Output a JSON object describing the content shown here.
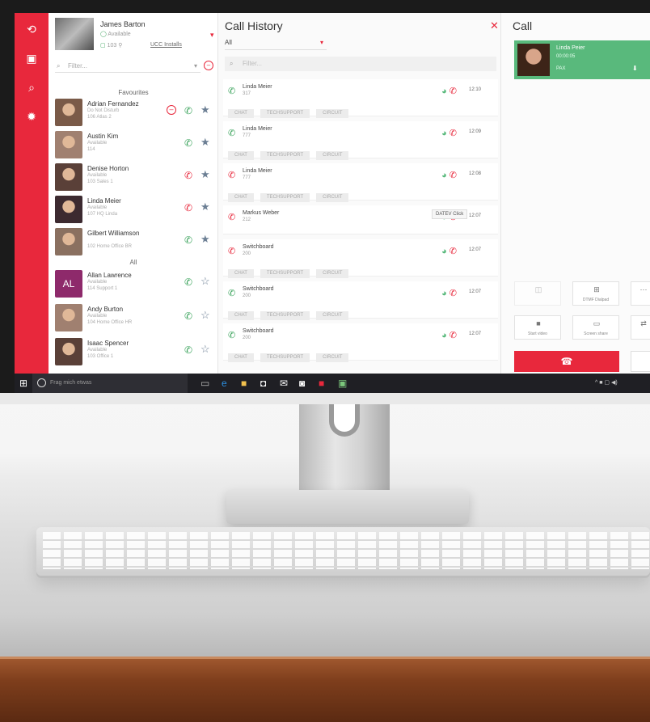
{
  "colors": {
    "accent": "#e8283c",
    "active_call": "#59b97c",
    "available": "#3aa35b"
  },
  "rail": {
    "icons": [
      "history-icon",
      "contacts-icon",
      "search-icon",
      "settings-icon"
    ]
  },
  "user": {
    "name": "James Barton",
    "status": "Available",
    "extension": "103",
    "uc_link": "UCC Installs"
  },
  "contacts": {
    "filter_placeholder": "Filter...",
    "favourites_label": "Favourites",
    "all_label": "All",
    "favourites": [
      {
        "name": "Adrian Fernandez",
        "status": "Do Not Disturb",
        "detail": "106  Atlas 2",
        "phone_color": "#3aa35b",
        "dnd": true
      },
      {
        "name": "Austin Kim",
        "status": "Available",
        "detail": "114",
        "phone_color": "#3aa35b"
      },
      {
        "name": "Denise Horton",
        "status": "Available",
        "detail": "103  Sales 1",
        "phone_color": "#e8283c"
      },
      {
        "name": "Linda Meier",
        "status": "Available",
        "detail": "107  HQ Linda",
        "phone_color": "#e8283c"
      },
      {
        "name": "Gilbert Williamson",
        "status": "",
        "detail": "102  Home Office BR",
        "phone_color": "#3aa35b"
      }
    ],
    "all": [
      {
        "name": "Allan Lawrence",
        "initials": "AL",
        "status": "Available",
        "detail": "114  Support 1",
        "phone_color": "#3aa35b"
      },
      {
        "name": "Andy Burton",
        "status": "Available",
        "detail": "104  Home Office HR",
        "phone_color": "#3aa35b"
      },
      {
        "name": "Isaac Spencer",
        "status": "Available",
        "detail": "103  Office 1",
        "phone_color": "#3aa35b"
      }
    ]
  },
  "history": {
    "title": "Call History",
    "filter_select": "All",
    "search_placeholder": "Filter...",
    "tags": [
      "CHAT",
      "TECHSUPPORT",
      "CIRCUIT"
    ],
    "rows": [
      {
        "name": "Linda Meier",
        "ext": "317",
        "time": "12:10",
        "dir_color": "#3aa35b",
        "tags": true
      },
      {
        "name": "Linda Meier",
        "ext": "777",
        "time": "12:09",
        "dir_color": "#3aa35b",
        "tags": true
      },
      {
        "name": "Linda Meier",
        "ext": "777",
        "time": "12:08",
        "dir_color": "#e8283c",
        "tags": true
      },
      {
        "name": "Markus Weber",
        "ext": "212",
        "time": "12:07",
        "dir_color": "#e8283c",
        "tags": false
      },
      {
        "name": "Switchboard",
        "ext": "200",
        "time": "12:07",
        "dir_color": "#e8283c",
        "tags": true
      },
      {
        "name": "Switchboard",
        "ext": "200",
        "time": "12:07",
        "dir_color": "#3aa35b",
        "tags": true
      },
      {
        "name": "Switchboard",
        "ext": "200",
        "time": "12:07",
        "dir_color": "#3aa35b",
        "tags": true
      }
    ],
    "tooltip": "DATEV Click"
  },
  "call": {
    "title": "Call",
    "caller": "Linda Peier",
    "duration": "00:00:05",
    "caller_sub": "PAX",
    "buttons": [
      "",
      "DTMF Dialpad",
      "Start video",
      "Screen share"
    ]
  },
  "taskbar": {
    "search_placeholder": "Frag mich etwas"
  }
}
